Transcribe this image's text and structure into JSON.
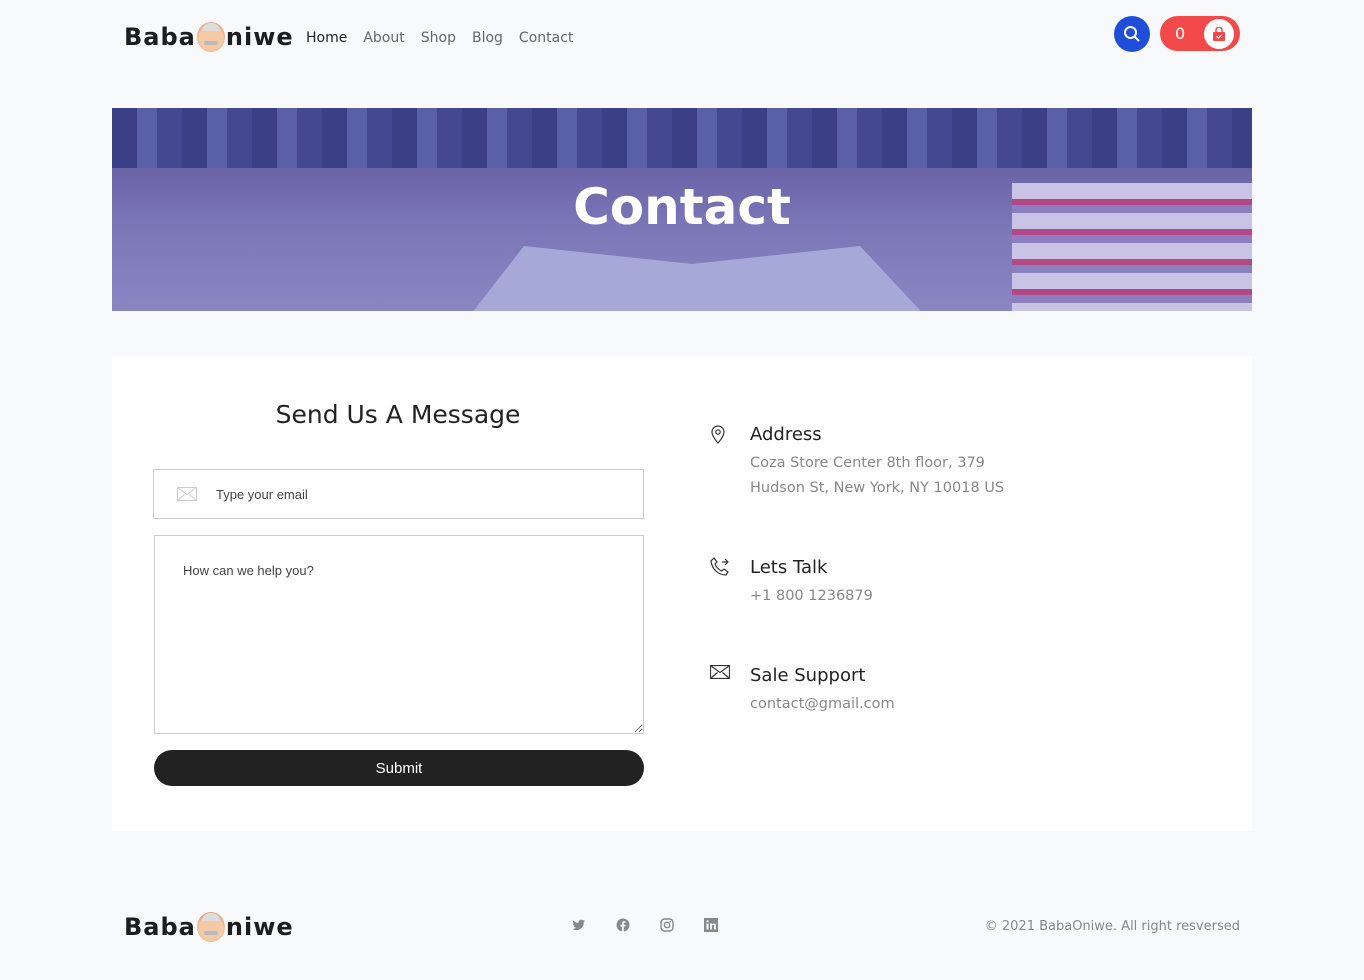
{
  "header": {
    "logo_left": "Baba",
    "logo_right": "niwe",
    "nav": [
      {
        "label": "Home",
        "active": true
      },
      {
        "label": "About"
      },
      {
        "label": "Shop"
      },
      {
        "label": "Blog"
      },
      {
        "label": "Contact"
      }
    ],
    "cart_count": "0",
    "accent": "#1f4fd8",
    "cart_color": "#f24a4a"
  },
  "banner": {
    "title": "Contact"
  },
  "form": {
    "title": "Send Us A Message",
    "email_placeholder": "Type your email",
    "message_placeholder": "How can we help you?",
    "submit": "Submit"
  },
  "info": [
    {
      "icon": "map-pin-icon",
      "title": "Address",
      "lines": [
        "Coza Store Center 8th floor, 379",
        "Hudson St, New York, NY 10018 US"
      ]
    },
    {
      "icon": "phone-icon",
      "title": "Lets Talk",
      "lines": [
        "+1 800 1236879"
      ]
    },
    {
      "icon": "envelope-icon",
      "title": "Sale Support",
      "lines": [
        "contact@gmail.com"
      ]
    }
  ],
  "footer": {
    "logo_left": "Baba",
    "logo_right": "niwe",
    "social": [
      "twitter-icon",
      "facebook-icon",
      "instagram-icon",
      "linkedin-icon"
    ],
    "copyright": "© 2021 BabaOniwe. All right resversed"
  }
}
